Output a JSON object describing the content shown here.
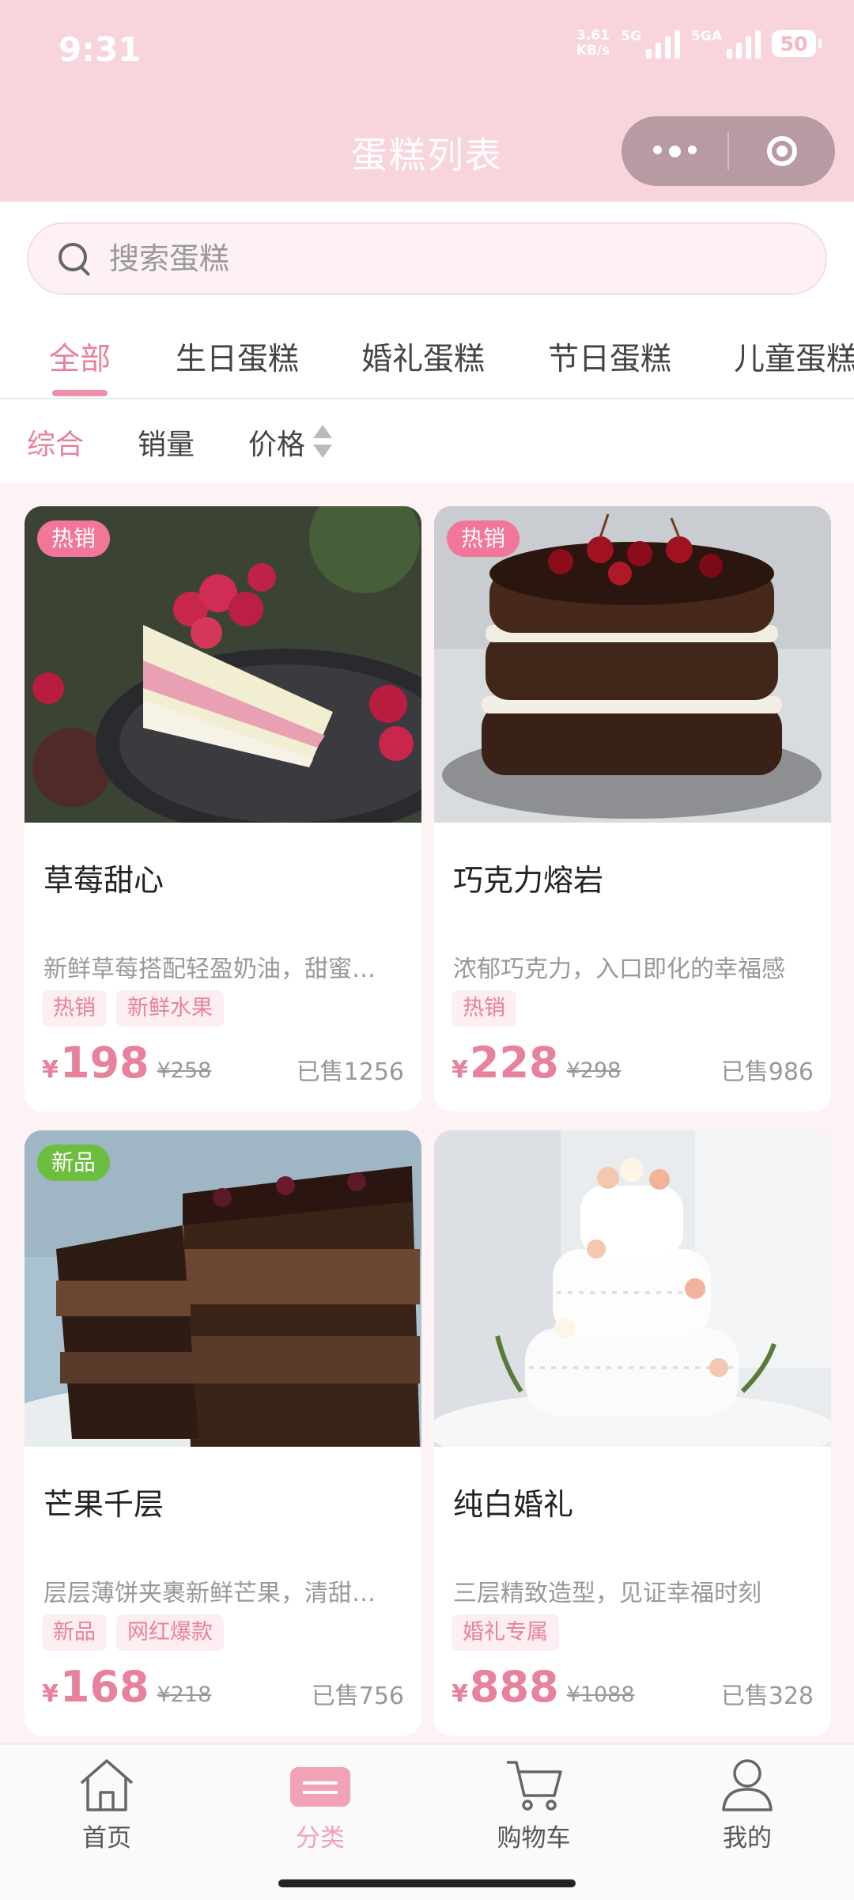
{
  "status": {
    "time": "9:31",
    "net_speed_value": "3.61",
    "net_speed_unit": "KB/s",
    "sim1": "5G",
    "sim2": "5GA",
    "battery": "50"
  },
  "nav": {
    "title": "蛋糕列表"
  },
  "search": {
    "placeholder": "搜索蛋糕"
  },
  "tabs": [
    "全部",
    "生日蛋糕",
    "婚礼蛋糕",
    "节日蛋糕",
    "儿童蛋糕"
  ],
  "active_tab": "全部",
  "sort": {
    "comprehensive": "综合",
    "sales": "销量",
    "price": "价格",
    "active": "综合"
  },
  "products": [
    {
      "name": "草莓甜心",
      "badge": "热销",
      "badge_color": "#f2769a",
      "desc": "新鲜草莓搭配轻盈奶油，甜蜜…",
      "tags": [
        "热销",
        "新鲜水果"
      ],
      "yen": "¥",
      "price": "198",
      "original": "¥258",
      "sold": "已售1256"
    },
    {
      "name": "巧克力熔岩",
      "badge": "热销",
      "badge_color": "#f2769a",
      "desc": "浓郁巧克力，入口即化的幸福感",
      "tags": [
        "热销"
      ],
      "yen": "¥",
      "price": "228",
      "original": "¥298",
      "sold": "已售986"
    },
    {
      "name": "芒果千层",
      "badge": "新品",
      "badge_color": "#6dbd3f",
      "desc": "层层薄饼夹裹新鲜芒果，清甜…",
      "tags": [
        "新品",
        "网红爆款"
      ],
      "yen": "¥",
      "price": "168",
      "original": "¥218",
      "sold": "已售756"
    },
    {
      "name": "纯白婚礼",
      "badge": "",
      "badge_color": "",
      "desc": "三层精致造型，见证幸福时刻",
      "tags": [
        "婚礼专属"
      ],
      "yen": "¥",
      "price": "888",
      "original": "¥1088",
      "sold": "已售328"
    }
  ],
  "bottom_nav": [
    {
      "label": "首页",
      "icon": "home-icon"
    },
    {
      "label": "分类",
      "icon": "category-icon",
      "active": true
    },
    {
      "label": "购物车",
      "icon": "cart-icon"
    },
    {
      "label": "我的",
      "icon": "profile-icon"
    }
  ],
  "colors": {
    "accent": "#e8819c",
    "header": "#f8d5dd"
  }
}
